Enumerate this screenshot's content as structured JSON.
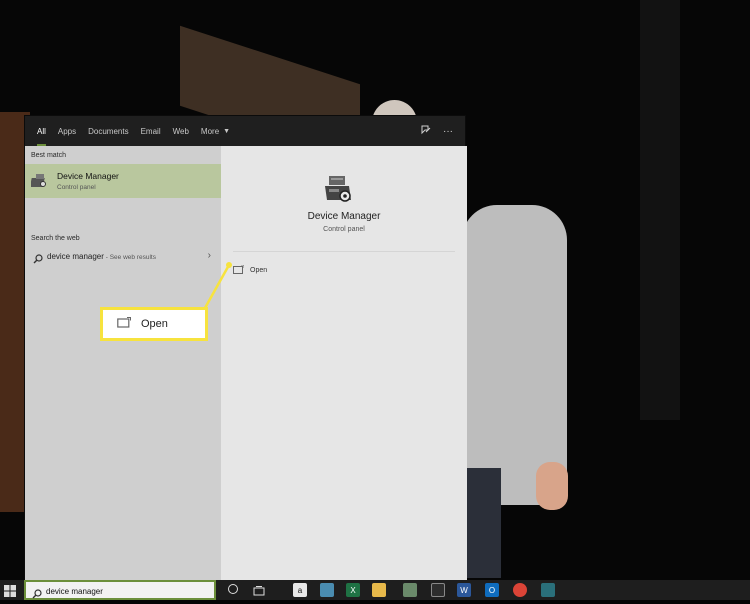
{
  "start_menu": {
    "tabs": [
      {
        "label": "All"
      },
      {
        "label": "Apps"
      },
      {
        "label": "Documents"
      },
      {
        "label": "Email"
      },
      {
        "label": "Web"
      },
      {
        "label": "More"
      }
    ],
    "best_match": {
      "title": "Best match",
      "name": "Device Manager",
      "subtitle": "Control panel"
    },
    "search_web": {
      "title": "Search the web",
      "query": "device manager",
      "suffix": " - See web results"
    },
    "details": {
      "name": "Device Manager",
      "subtitle": "Control panel",
      "action_open": "Open"
    }
  },
  "callout": {
    "label": "Open"
  },
  "taskbar": {
    "search_value": "device manager",
    "app_icons": [
      "file-explorer-icon",
      "excel-icon",
      "folder-icon",
      "photos-icon",
      "gallery-icon",
      "word-icon",
      "outlook-icon",
      "chrome-icon",
      "defender-icon"
    ]
  },
  "colors": {
    "accent": "#6c8f3b",
    "selection": "#b9c79e",
    "callout_border": "#f7e33e",
    "topbar": "#1f1f1f"
  }
}
